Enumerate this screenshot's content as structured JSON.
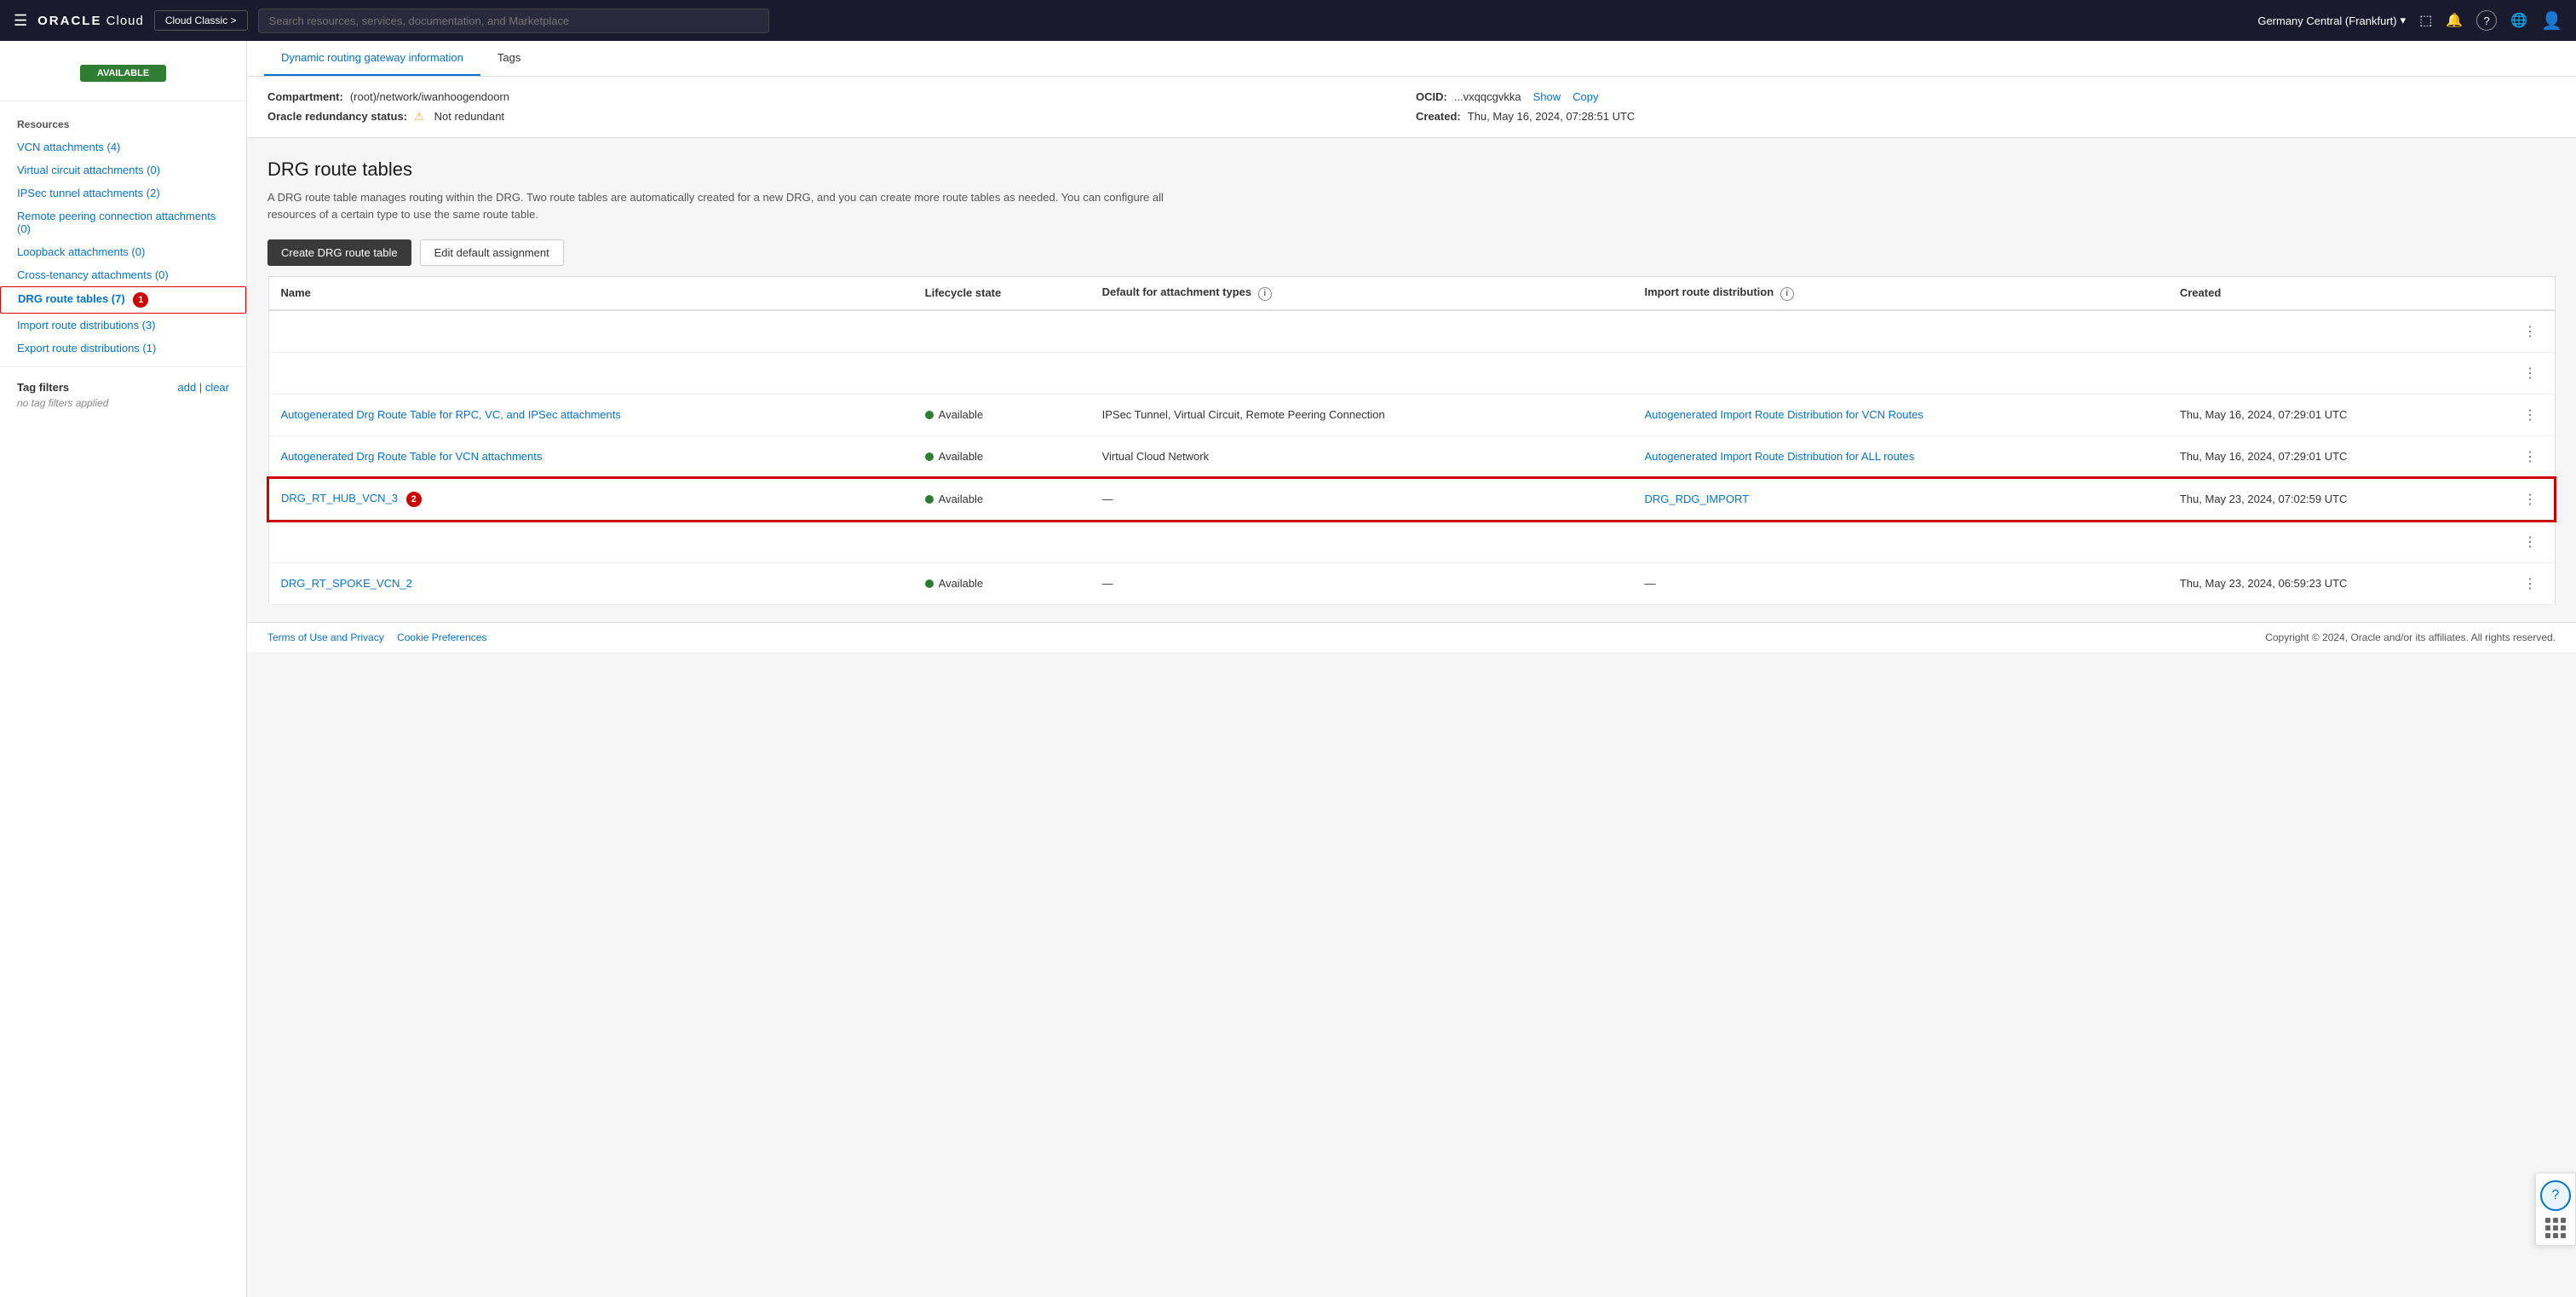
{
  "nav": {
    "hamburger": "☰",
    "logo_oracle": "ORACLE",
    "logo_cloud": " Cloud",
    "classic_btn": "Cloud Classic >",
    "search_placeholder": "Search resources, services, documentation, and Marketplace",
    "region": "Germany Central (Frankfurt)",
    "icon_code": "⬚",
    "icon_bell": "🔔",
    "icon_question": "?",
    "icon_globe": "🌐",
    "icon_user": "👤"
  },
  "sidebar": {
    "available_badge": "AVAILABLE",
    "resources_title": "Resources",
    "items": [
      {
        "label": "VCN attachments (4)",
        "active": false
      },
      {
        "label": "Virtual circuit attachments (0)",
        "active": false
      },
      {
        "label": "IPSec tunnel attachments (2)",
        "active": false
      },
      {
        "label": "Remote peering connection attachments (0)",
        "active": false
      },
      {
        "label": "Loopback attachments (0)",
        "active": false
      },
      {
        "label": "Cross-tenancy attachments (0)",
        "active": false
      },
      {
        "label": "DRG route tables (7)",
        "active": true,
        "badge": "1"
      },
      {
        "label": "Import route distributions (3)",
        "active": false
      },
      {
        "label": "Export route distributions (1)",
        "active": false
      }
    ],
    "tag_filters_title": "Tag filters",
    "tag_add": "add",
    "tag_separator": " | ",
    "tag_clear": "clear",
    "no_filters": "no tag filters applied"
  },
  "info_panel": {
    "tabs": [
      {
        "label": "Dynamic routing gateway information",
        "active": true
      },
      {
        "label": "Tags",
        "active": false
      }
    ],
    "compartment_label": "Compartment:",
    "compartment_value": "(root)/network/iwanhoogendoorn",
    "ocid_label": "OCID:",
    "ocid_value": "...vxqqcgvkka",
    "ocid_show": "Show",
    "ocid_copy": "Copy",
    "redundancy_label": "Oracle redundancy status:",
    "redundancy_warning": "⚠",
    "redundancy_value": "Not redundant",
    "created_label": "Created:",
    "created_value": "Thu, May 16, 2024, 07:28:51 UTC"
  },
  "drg": {
    "title": "DRG route tables",
    "description": "A DRG route table manages routing within the DRG. Two route tables are automatically created for a new DRG, and you can create more route tables as needed. You can configure all resources of a certain type to use the same route table.",
    "create_btn": "Create DRG route table",
    "edit_btn": "Edit default assignment",
    "table": {
      "columns": [
        {
          "label": "Name"
        },
        {
          "label": "Lifecycle state"
        },
        {
          "label": "Default for attachment types",
          "has_info": true
        },
        {
          "label": "Import route distribution",
          "has_info": true
        },
        {
          "label": "Created"
        }
      ],
      "rows": [
        {
          "empty": true
        },
        {
          "empty": true
        },
        {
          "name": "Autogenerated Drg Route Table for RPC, VC, and IPSec attachments",
          "state": "Available",
          "default_for": "IPSec Tunnel, Virtual Circuit, Remote Peering Connection",
          "import_dist": "Autogenerated Import Route Distribution for VCN Routes",
          "created": "Thu, May 16, 2024, 07:29:01 UTC",
          "highlighted": false
        },
        {
          "name": "Autogenerated Drg Route Table for VCN attachments",
          "state": "Available",
          "default_for": "Virtual Cloud Network",
          "import_dist": "Autogenerated Import Route Distribution for ALL routes",
          "created": "Thu, May 16, 2024, 07:29:01 UTC",
          "highlighted": false
        },
        {
          "name": "DRG_RT_HUB_VCN_3",
          "state": "Available",
          "default_for": "—",
          "import_dist": "DRG_RDG_IMPORT",
          "created": "Thu, May 23, 2024, 07:02:59 UTC",
          "highlighted": true,
          "badge": "2"
        },
        {
          "empty": true
        },
        {
          "name": "DRG_RT_SPOKE_VCN_2",
          "state": "Available",
          "default_for": "—",
          "import_dist": "—",
          "created": "Thu, May 23, 2024, 06:59:23 UTC",
          "highlighted": false
        }
      ]
    }
  },
  "footer": {
    "terms": "Terms of Use and Privacy",
    "cookie": "Cookie Preferences",
    "copyright": "Copyright © 2024, Oracle and/or its affiliates. All rights reserved."
  }
}
